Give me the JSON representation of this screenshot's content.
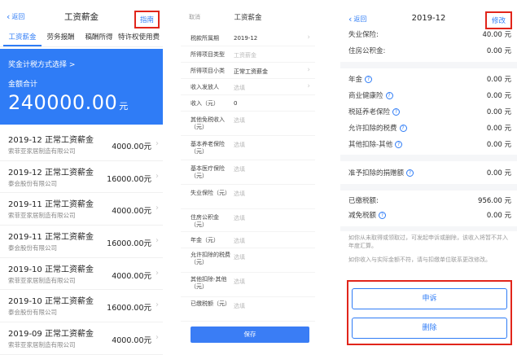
{
  "panel1": {
    "back_label": "返回",
    "title": "工资薪金",
    "action_label": "指南",
    "tabs": [
      "工资薪金",
      "劳务报酬",
      "稿酬所得",
      "特许权使用费"
    ],
    "banner": {
      "line1": "奖金计税方式选择 >",
      "line2": "金额合计",
      "amount": "240000.00",
      "unit": "元"
    },
    "records": [
      {
        "title": "2019-12 正常工资薪金",
        "company": "索菲亚家居制造有限公司",
        "amount": "4000.00元"
      },
      {
        "title": "2019-12 正常工资薪金",
        "company": "泰会股份有限公司",
        "amount": "16000.00元"
      },
      {
        "title": "2019-11 正常工资薪金",
        "company": "索菲亚家居制造有限公司",
        "amount": "4000.00元"
      },
      {
        "title": "2019-11 正常工资薪金",
        "company": "泰会股份有限公司",
        "amount": "16000.00元"
      },
      {
        "title": "2019-10 正常工资薪金",
        "company": "索菲亚家居制造有限公司",
        "amount": "4000.00元"
      },
      {
        "title": "2019-10 正常工资薪金",
        "company": "泰会股份有限公司",
        "amount": "16000.00元"
      },
      {
        "title": "2019-09 正常工资薪金",
        "company": "索菲亚家居制造有限公司",
        "amount": "4000.00元"
      }
    ]
  },
  "panel2": {
    "back_label": "取消",
    "title": "工资薪金",
    "fields": [
      {
        "label": "税款所属期",
        "value": "2019-12",
        "placeholder": false,
        "chevron": true
      },
      {
        "label": "所得项目类型",
        "value": "工资薪金",
        "placeholder": true,
        "chevron": false
      },
      {
        "label": "所得项目小类",
        "value": "正常工资薪金",
        "placeholder": false,
        "chevron": true
      },
      {
        "label": "收入发放人",
        "value": "选填",
        "placeholder": true,
        "chevron": true
      },
      {
        "label": "收入（元）",
        "value": "0",
        "placeholder": false,
        "chevron": false
      },
      {
        "label": "其他免税收入（元）",
        "value": "选填",
        "placeholder": true,
        "chevron": false
      },
      {
        "label": "基本养老保险（元）",
        "value": "选填",
        "placeholder": true,
        "chevron": false
      },
      {
        "label": "基本医疗保险（元）",
        "value": "选填",
        "placeholder": true,
        "chevron": false
      },
      {
        "label": "失业保险（元）",
        "value": "选填",
        "placeholder": true,
        "chevron": false
      },
      {
        "label": "住房公积金（元）",
        "value": "选填",
        "placeholder": true,
        "chevron": false
      },
      {
        "label": "年金（元）",
        "value": "选填",
        "placeholder": true,
        "chevron": false
      },
      {
        "label": "允许扣除的税费（元）",
        "value": "选填",
        "placeholder": true,
        "chevron": false
      },
      {
        "label": "其他扣除-其他（元）",
        "value": "选填",
        "placeholder": true,
        "chevron": false
      },
      {
        "label": "已缴税额（元）",
        "value": "选填",
        "placeholder": true,
        "chevron": false
      }
    ],
    "save_label": "保存"
  },
  "panel3": {
    "back_label": "返回",
    "title": "2019-12",
    "action_label": "修改",
    "group1": [
      {
        "label": "失业保险:",
        "value": "40.00 元"
      },
      {
        "label": "住房公积金:",
        "value": "0.00 元"
      }
    ],
    "group2": [
      {
        "label": "年金",
        "value": "0.00 元"
      },
      {
        "label": "商业健康险",
        "value": "0.00 元"
      },
      {
        "label": "税延养老保险",
        "value": "0.00 元"
      },
      {
        "label": "允许扣除的税费",
        "value": "0.00 元"
      },
      {
        "label": "其他扣除-其他",
        "value": "0.00 元"
      }
    ],
    "group3": [
      {
        "label": "准予扣除的捐赠额",
        "value": "0.00 元"
      }
    ],
    "group4": [
      {
        "label": "已缴税额:",
        "value": "956.00 元"
      },
      {
        "label": "减免税额",
        "value": "0.00 元"
      }
    ],
    "note1": "如你从未取得或领取过，可发起申诉或删除，该收入将暂不并入年度汇算。",
    "note2": "如你收入与实际金额不符，请与扣缴单位联系更改修改。",
    "appeal_label": "申诉",
    "delete_label": "删除"
  },
  "colors": {
    "accent": "#2f7cf6",
    "highlight": "#e1251b"
  }
}
